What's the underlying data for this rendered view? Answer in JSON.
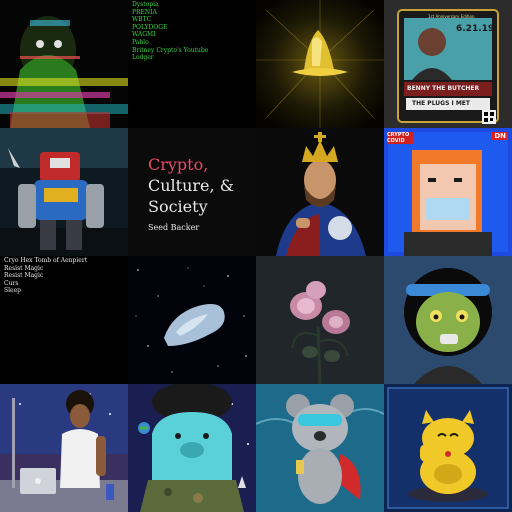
{
  "tiles": {
    "t1_list": [
      "Dystopia",
      "PRENIA",
      "WBTC",
      "POLYDOGE",
      "WAGMI",
      "Pablo",
      "Britney Crypto's Youtube",
      "Ledger"
    ],
    "t3_card": {
      "badge": "1st Anniversary Edition",
      "date": "6.21.19",
      "name": "BENNY THE BUTCHER",
      "caption": "THE PLUGS I MET"
    },
    "title_card": {
      "accent": "Crypto,",
      "line2": "Culture, &",
      "line3": "Society",
      "subtitle": "Seed Backer"
    },
    "t7_logos": {
      "left": "CRYPTO COVID",
      "right": "DN"
    },
    "t9_list": [
      "Cryo Hex Tomb of Aenpiert",
      "Resist Magic",
      "Resist Magic",
      "Curs",
      "Sleep"
    ]
  },
  "colors": {
    "accent_pink": "#e84a6a",
    "list_green": "#3fd84a",
    "selected_outline": "#ffffff"
  }
}
